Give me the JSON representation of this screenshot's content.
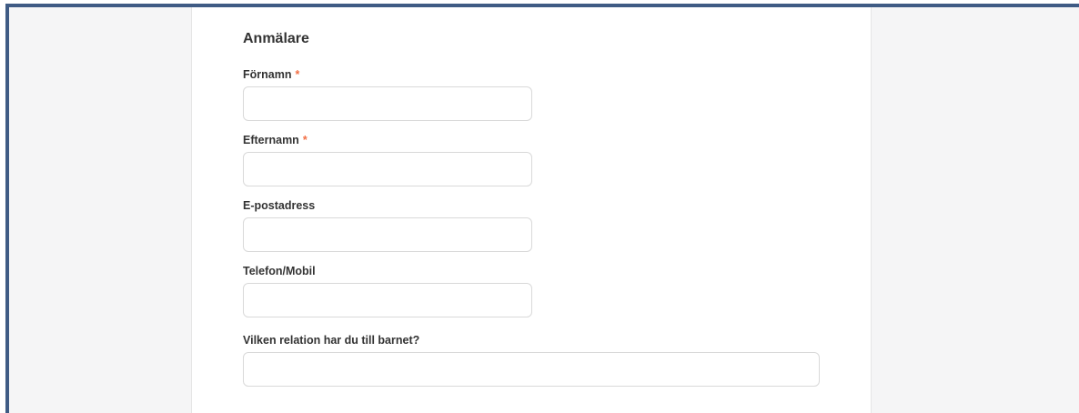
{
  "form": {
    "section_title": "Anmälare",
    "required_marker": "*",
    "fields": [
      {
        "label": "Förnamn",
        "required": true,
        "value": ""
      },
      {
        "label": "Efternamn",
        "required": true,
        "value": ""
      },
      {
        "label": "E-postadress",
        "required": false,
        "value": ""
      },
      {
        "label": "Telefon/Mobil",
        "required": false,
        "value": ""
      },
      {
        "label": "Vilken relation har du till barnet?",
        "required": false,
        "value": ""
      }
    ]
  },
  "colors": {
    "frame_border": "#3f5b84",
    "required_marker": "#f26f45",
    "page_background": "#f5f5f6",
    "content_background": "#ffffff"
  }
}
